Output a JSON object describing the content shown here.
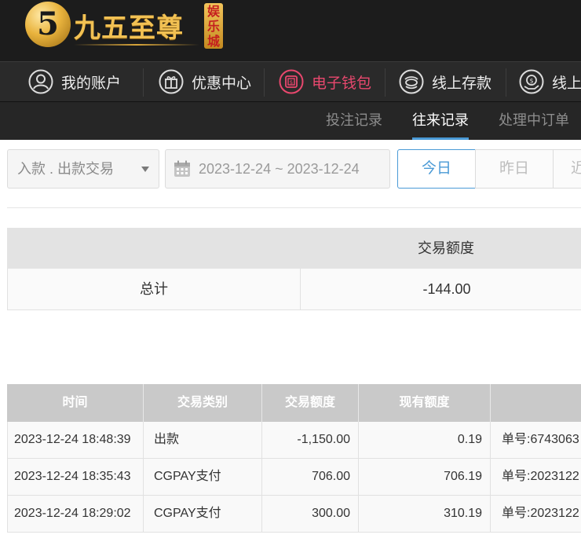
{
  "brand": {
    "logo_digit": "5",
    "name": "九五至尊",
    "badge": "娱乐城"
  },
  "main_nav": [
    {
      "label": "我的账户",
      "icon": "user-icon"
    },
    {
      "label": "优惠中心",
      "icon": "gift-icon"
    },
    {
      "label": "电子钱包",
      "icon": "wallet-icon"
    },
    {
      "label": "线上存款",
      "icon": "deposit-icon"
    },
    {
      "label": "线上",
      "icon": "withdraw-icon"
    }
  ],
  "sub_nav": [
    {
      "label": "投注记录"
    },
    {
      "label": "往来记录"
    },
    {
      "label": "处理中订单"
    }
  ],
  "filters": {
    "type_select": "入款 . 出款交易",
    "date_range": "2023-12-24 ~ 2023-12-24",
    "buttons": [
      "今日",
      "昨日",
      "近"
    ]
  },
  "summary": {
    "header": "交易额度",
    "label": "总计",
    "value": "-144.00"
  },
  "records": {
    "headers": [
      "时间",
      "交易类别",
      "交易额度",
      "现有额度",
      ""
    ],
    "rows": [
      {
        "time": "2023-12-24 18:48:39",
        "type": "出款",
        "amount": "-1,150.00",
        "balance": "0.19",
        "note": "单号:6743063"
      },
      {
        "time": "2023-12-24 18:35:43",
        "type": "CGPAY支付",
        "amount": "706.00",
        "balance": "706.19",
        "note": "单号:2023122"
      },
      {
        "time": "2023-12-24 18:29:02",
        "type": "CGPAY支付",
        "amount": "300.00",
        "balance": "310.19",
        "note": "单号:2023122"
      }
    ]
  },
  "colors": {
    "accent_blue": "#4a9ad6",
    "active_nav_pink": "#e9486e",
    "header_bg": "#1c1c1c",
    "brand_gold": "#f2c153"
  }
}
